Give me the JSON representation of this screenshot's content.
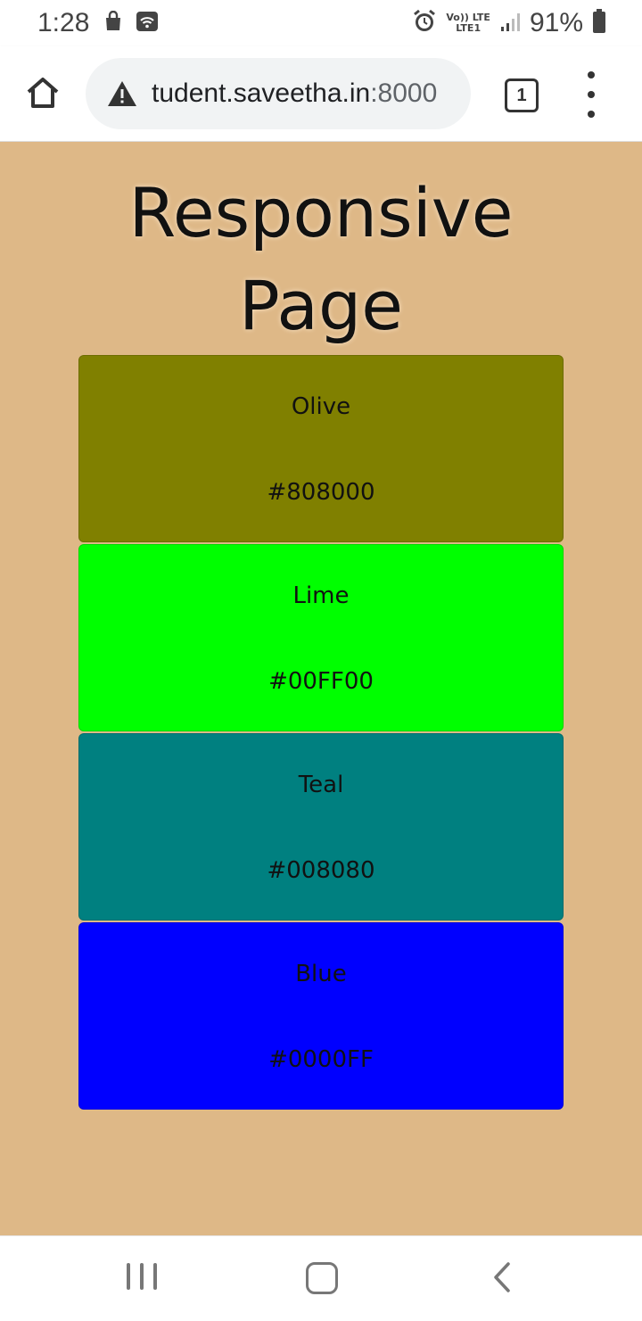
{
  "status_bar": {
    "time": "1:28",
    "lte_top": "Vo)) LTE",
    "lte_bottom": "LTE1",
    "battery_percent": "91%",
    "icons": [
      "shopping-bag-icon",
      "wifi-cast-icon",
      "alarm-icon",
      "signal-icon",
      "battery-icon"
    ]
  },
  "browser": {
    "url_host": "tudent.saveetha.in",
    "url_port": ":8000",
    "tab_count": "1",
    "icons": [
      "home-icon",
      "warning-icon",
      "tabs-icon",
      "more-vert-icon"
    ]
  },
  "page": {
    "title_line1": "Responsive",
    "title_line2": "Page",
    "background": "#DEB887",
    "colors": [
      {
        "name": "Olive",
        "hex": "#808000",
        "swatch": "#808000"
      },
      {
        "name": "Lime",
        "hex": "#00FF00",
        "swatch": "#00FF00"
      },
      {
        "name": "Teal",
        "hex": "#008080",
        "swatch": "#008080"
      },
      {
        "name": "Blue",
        "hex": "#0000FF",
        "swatch": "#0000FF"
      }
    ]
  },
  "nav_bar": {
    "icons": [
      "recents-icon",
      "home-nav-icon",
      "back-icon"
    ]
  }
}
